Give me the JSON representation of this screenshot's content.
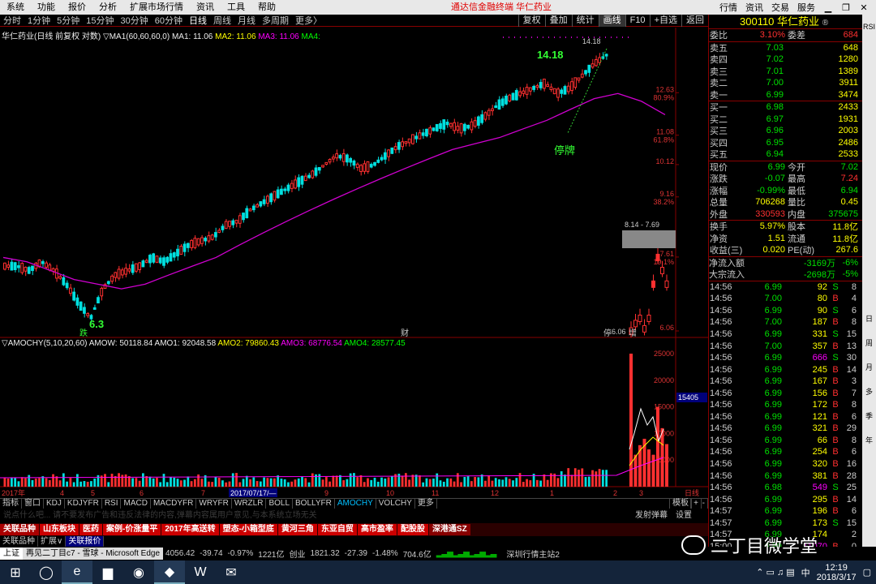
{
  "menubar": {
    "items": [
      "系统",
      "功能",
      "报价",
      "分析",
      "扩展市场行情",
      "资讯",
      "工具",
      "帮助"
    ],
    "brand": "通达信金融终端  华仁药业",
    "right_items": [
      "行情",
      "资讯",
      "交易",
      "服务"
    ]
  },
  "periodbar": {
    "periods": [
      "分时",
      "1分钟",
      "5分钟",
      "15分钟",
      "30分钟",
      "60分钟",
      "日线",
      "周线",
      "月线",
      "多周期",
      "更多〉"
    ],
    "active_index": 6,
    "tools": [
      "复权",
      "叠加",
      "统计",
      "画线",
      "F10",
      "+自选",
      "返回"
    ],
    "active_tool_index": 3
  },
  "chart_title": {
    "name": "华仁药业(日线 前复权 对数)",
    "ma_label": "▽MA1(60,60,60,0)",
    "ma1": "MA1: 11.06",
    "ma2": "MA2: 11.06",
    "ma3": "MA3: 11.06",
    "ma4": "MA4:"
  },
  "ind_title": {
    "name": "▽AMOCHY(5,10,20,60)",
    "amow": "AMOW: 50118.84",
    "amo1": "AMO1: 92048.58",
    "amo2": "AMO2: 79860.43",
    "amo3": "AMO3: 68776.54",
    "amo4": "AMO4: 28577.45"
  },
  "annotations": {
    "high": "14.18",
    "low": "6.3",
    "halt": "停牌",
    "range_box": "8.14 - 7.69",
    "high_small": "14.18",
    "low_small": "6.06",
    "vol_current": "15405"
  },
  "price_axis": [
    {
      "value": "12.63",
      "pct": "80.9%"
    },
    {
      "value": "11.08",
      "pct": "61.8%"
    },
    {
      "value": "10.12",
      "pct": ""
    },
    {
      "value": "9.16",
      "pct": "38.2%"
    },
    {
      "value": "7.61",
      "pct": "19.1%"
    },
    {
      "value": "6.06",
      "pct": ""
    }
  ],
  "vol_axis": [
    "25000",
    "20000",
    "15000",
    "10000",
    "5000"
  ],
  "date_axis": [
    "2017年",
    "4",
    "5",
    "6",
    "7",
    "2017/07/17/—",
    "9",
    "10",
    "11",
    "12",
    "1",
    "2",
    "3",
    "日线"
  ],
  "markers": {
    "die": "跌",
    "cai": "财",
    "fu": "停",
    "zeng": "增"
  },
  "indbar": {
    "items": [
      "指标",
      "窗口",
      "KDJ",
      "KDJYFR",
      "RSI",
      "MACD",
      "MACDYFR",
      "WRYFR",
      "WRZLR",
      "BOLL",
      "BOLLYFR",
      "AMOCHY",
      "VOLCHY",
      "更多"
    ],
    "active_index": 11,
    "template": "模板",
    "plus": "+",
    "minus": "-"
  },
  "msgbar": {
    "hint": "说点什么吧... 请不要发布广告和违反法律的内容,弹幕内容属用户意见,与本系统立场无关",
    "send": "发射弹幕",
    "settings": "设置"
  },
  "boardbar": [
    "关联品种",
    "山东板块",
    "医药",
    "案例-价涨量平",
    "2017年高送转",
    "塑态-小箱型底",
    "黄河三角",
    "东亚自贸",
    "高市盈率",
    "配股股",
    "深港通SZ"
  ],
  "favbar": [
    "关联品种",
    "扩展∨",
    "关联报价"
  ],
  "rpanel": {
    "code": "300110",
    "name": "华仁药业",
    "webi_label": "委比",
    "webi": "3.10%",
    "weicha_label": "委差",
    "weicha": "684",
    "asks": [
      {
        "label": "卖五",
        "price": "7.03",
        "vol": "648"
      },
      {
        "label": "卖四",
        "price": "7.02",
        "vol": "1280"
      },
      {
        "label": "卖三",
        "price": "7.01",
        "vol": "1389"
      },
      {
        "label": "卖二",
        "price": "7.00",
        "vol": "3911"
      },
      {
        "label": "卖一",
        "price": "6.99",
        "vol": "3474"
      }
    ],
    "bids": [
      {
        "label": "买一",
        "price": "6.98",
        "vol": "2433"
      },
      {
        "label": "买二",
        "price": "6.97",
        "vol": "1931"
      },
      {
        "label": "买三",
        "price": "6.96",
        "vol": "2003"
      },
      {
        "label": "买四",
        "price": "6.95",
        "vol": "2486"
      },
      {
        "label": "买五",
        "price": "6.94",
        "vol": "2533"
      }
    ],
    "quote": [
      {
        "l1": "现价",
        "v1": "6.99",
        "c1": "green",
        "l2": "今开",
        "v2": "7.02",
        "c2": "green"
      },
      {
        "l1": "涨跌",
        "v1": "-0.07",
        "c1": "green",
        "l2": "最高",
        "v2": "7.24",
        "c2": "red"
      },
      {
        "l1": "涨幅",
        "v1": "-0.99%",
        "c1": "green",
        "l2": "最低",
        "v2": "6.94",
        "c2": "green"
      },
      {
        "l1": "总量",
        "v1": "706268",
        "c1": "yellow",
        "l2": "量比",
        "v2": "0.45",
        "c2": "yellow"
      },
      {
        "l1": "外盘",
        "v1": "330593",
        "c1": "red",
        "l2": "内盘",
        "v2": "375675",
        "c2": "green"
      }
    ],
    "fund": [
      {
        "l1": "换手",
        "v1": "5.97%",
        "l2": "股本",
        "v2": "11.8亿"
      },
      {
        "l1": "净资",
        "v1": "1.51",
        "l2": "流通",
        "v2": "11.8亿"
      },
      {
        "l1": "收益(三)",
        "v1": "0.020",
        "l2": "PE(动)",
        "v2": "267.6"
      }
    ],
    "flow": [
      {
        "l": "净流入额",
        "v": "-3169万",
        "p": "-6%"
      },
      {
        "l": "大宗流入",
        "v": "-2698万",
        "p": "-5%"
      }
    ],
    "ticks": [
      {
        "t": "14:56",
        "p": "6.99",
        "pc": "green",
        "v": "92",
        "bs": "S",
        "c": "8"
      },
      {
        "t": "14:56",
        "p": "7.00",
        "pc": "green",
        "v": "80",
        "bs": "B",
        "c": "4"
      },
      {
        "t": "14:56",
        "p": "6.99",
        "pc": "green",
        "v": "90",
        "bs": "S",
        "c": "6"
      },
      {
        "t": "14:56",
        "p": "7.00",
        "pc": "green",
        "v": "187",
        "bs": "B",
        "c": "8"
      },
      {
        "t": "14:56",
        "p": "6.99",
        "pc": "green",
        "v": "331",
        "bs": "S",
        "c": "15"
      },
      {
        "t": "14:56",
        "p": "7.00",
        "pc": "green",
        "v": "357",
        "bs": "B",
        "c": "13"
      },
      {
        "t": "14:56",
        "p": "6.99",
        "pc": "green",
        "v": "666",
        "bs": "S",
        "c": "30"
      },
      {
        "t": "14:56",
        "p": "6.99",
        "pc": "green",
        "v": "245",
        "bs": "B",
        "c": "14"
      },
      {
        "t": "14:56",
        "p": "6.99",
        "pc": "green",
        "v": "167",
        "bs": "B",
        "c": "3"
      },
      {
        "t": "14:56",
        "p": "6.99",
        "pc": "green",
        "v": "156",
        "bs": "B",
        "c": "7"
      },
      {
        "t": "14:56",
        "p": "6.99",
        "pc": "green",
        "v": "172",
        "bs": "B",
        "c": "8"
      },
      {
        "t": "14:56",
        "p": "6.99",
        "pc": "green",
        "v": "121",
        "bs": "B",
        "c": "6"
      },
      {
        "t": "14:56",
        "p": "6.99",
        "pc": "green",
        "v": "321",
        "bs": "B",
        "c": "29"
      },
      {
        "t": "14:56",
        "p": "6.99",
        "pc": "green",
        "v": "66",
        "bs": "B",
        "c": "8"
      },
      {
        "t": "14:56",
        "p": "6.99",
        "pc": "green",
        "v": "254",
        "bs": "B",
        "c": "6"
      },
      {
        "t": "14:56",
        "p": "6.99",
        "pc": "green",
        "v": "320",
        "bs": "B",
        "c": "16"
      },
      {
        "t": "14:56",
        "p": "6.99",
        "pc": "green",
        "v": "381",
        "bs": "B",
        "c": "28"
      },
      {
        "t": "14:56",
        "p": "6.98",
        "pc": "green",
        "v": "549",
        "bs": "S",
        "c": "25"
      },
      {
        "t": "14:56",
        "p": "6.99",
        "pc": "green",
        "v": "295",
        "bs": "B",
        "c": "14"
      },
      {
        "t": "14:57",
        "p": "6.99",
        "pc": "green",
        "v": "196",
        "bs": "B",
        "c": "6"
      },
      {
        "t": "14:57",
        "p": "6.99",
        "pc": "green",
        "v": "173",
        "bs": "S",
        "c": "15"
      },
      {
        "t": "14:57",
        "p": "6.99",
        "pc": "green",
        "v": "174",
        "bs": "",
        "c": "2"
      },
      {
        "t": "15:00",
        "p": "6.99",
        "pc": "green",
        "v": "11070",
        "bs": "B",
        "c": "0"
      }
    ]
  },
  "sidestrip": [
    "RSI",
    "",
    "",
    "",
    "",
    "",
    "",
    "",
    "",
    "",
    "",
    "",
    "日",
    "周",
    "月",
    "多",
    "季",
    "年"
  ],
  "statusbar": {
    "edge_label": "上证",
    "edge_tab": "再见二丁目c7 - 雪球 - Microsoft Edge",
    "sh_index": "4056.42",
    "sh_change": "-39.74",
    "sh_pct": "-0.97%",
    "sh_amount": "1221亿",
    "cy_label": "创业",
    "cy_index": "1821.32",
    "cy_change": "-27.39",
    "cy_pct": "-1.48%",
    "cy_amount": "704.6亿",
    "server": "深圳行情主站2"
  },
  "taskbar": {
    "time": "12:19",
    "date": "2018/3/17",
    "ime": "中"
  },
  "watermark": "二丁目微学堂",
  "chart_data": {
    "type": "candlestick",
    "title": "华仁药业(日线 前复权 对数)",
    "x_range": [
      "2017年",
      "3"
    ],
    "y_range": [
      6.06,
      14.18
    ],
    "scale": "log",
    "price_path": [
      7.4,
      7.4,
      7.3,
      7.5,
      7.3,
      7.0,
      6.6,
      6.3,
      6.9,
      7.2,
      7.3,
      7.4,
      7.6,
      7.5,
      7.7,
      7.9,
      8.0,
      8.1,
      8.4,
      8.5,
      8.8,
      9.0,
      9.2,
      9.4,
      9.6,
      9.8,
      10.1,
      10.4,
      10.3,
      10.0,
      10.1,
      10.4,
      10.7,
      10.9,
      11.1,
      11.3,
      11.5,
      11.3,
      11.4,
      11.7,
      12.1,
      12.4,
      12.6,
      12.8,
      13.0,
      12.6,
      12.8,
      13.3,
      13.8,
      14.18
    ],
    "ma60_path": [
      7.6,
      7.5,
      7.3,
      7.1,
      7.0,
      6.9,
      7.0,
      7.2,
      7.4,
      7.6,
      7.9,
      8.2,
      8.5,
      8.8,
      9.1,
      9.4,
      9.7,
      10.0,
      10.3,
      10.6,
      10.8,
      11.0,
      11.3,
      11.6,
      12.0,
      12.4,
      12.6,
      12.3,
      11.8
    ],
    "after_halt": [
      6.06,
      6.2,
      6.3,
      6.1,
      6.3,
      7.0,
      7.6,
      7.3,
      7.0
    ],
    "volume_ylim": [
      0,
      25000
    ]
  }
}
